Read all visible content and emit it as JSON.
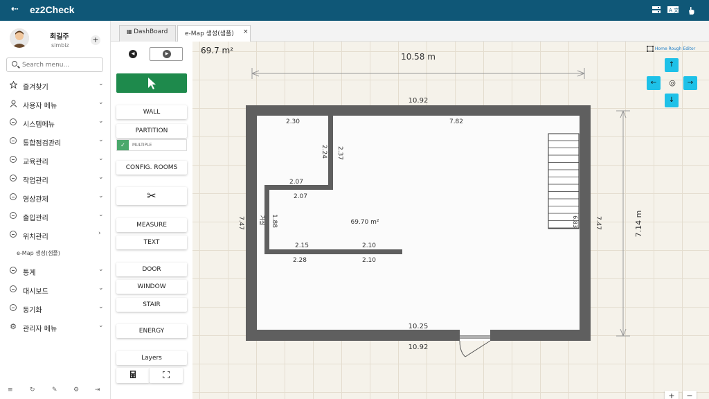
{
  "app": {
    "title": "ez2Check",
    "menu_toggle": "⇠"
  },
  "topbar": {
    "icons": [
      "server-icon",
      "translate-icon",
      "touch-icon"
    ]
  },
  "user": {
    "name": "최길주",
    "org": "simbiz",
    "add": "+"
  },
  "search": {
    "placeholder": "Search menu..."
  },
  "nav": [
    {
      "label": "즐겨찾기",
      "icon": "star-icon",
      "chev": "⌄"
    },
    {
      "label": "사용자 메뉴",
      "icon": "user-icon",
      "chev": "⌄"
    },
    {
      "label": "시스템메뉴",
      "icon": "minus-circle-icon",
      "chev": "⌄"
    },
    {
      "label": "통합점검관리",
      "icon": "minus-circle-icon",
      "chev": "⌄"
    },
    {
      "label": "교육관리",
      "icon": "minus-circle-icon",
      "chev": "⌄"
    },
    {
      "label": "작업관리",
      "icon": "minus-circle-icon",
      "chev": "⌄"
    },
    {
      "label": "영상관제",
      "icon": "minus-circle-icon",
      "chev": "⌄"
    },
    {
      "label": "출입관리",
      "icon": "minus-circle-icon",
      "chev": "⌄"
    },
    {
      "label": "위치관리",
      "icon": "minus-circle-icon",
      "chev": "›"
    },
    {
      "label": "통계",
      "icon": "minus-circle-icon",
      "chev": "⌄"
    },
    {
      "label": "대시보드",
      "icon": "minus-circle-icon",
      "chev": "⌄"
    },
    {
      "label": "동기화",
      "icon": "minus-circle-icon",
      "chev": "⌄"
    },
    {
      "label": "관리자 메뉴",
      "icon": "gear-icon",
      "chev": "⌄"
    }
  ],
  "nav_sub": "e-Map 생성(샘플)",
  "tabs": [
    {
      "label": "DashBoard",
      "icon": "table-icon"
    },
    {
      "label": "e-Map 생성(샘플)",
      "close": "×"
    }
  ],
  "tools": {
    "prev": "◀",
    "next": "▶",
    "wall": "WALL",
    "partition": "PARTITION",
    "multiple": "MULTIPLE",
    "multiple_checked": "✓",
    "config_rooms": "CONFIG. ROOMS",
    "cut": "✂",
    "measure": "MEASURE",
    "text": "TEXT",
    "door": "DOOR",
    "window": "WINDOW",
    "stair": "STAIR",
    "energy": "ENERGY",
    "layers": "Layers"
  },
  "canvas": {
    "total_area": "69.7 m²",
    "editor_link": "Home Rough Editor",
    "width_dim": "10.58 m",
    "height_dim": "7.14 m",
    "room_area": "69.70 m²",
    "room_label": "거실",
    "dims": {
      "top_outer": "10.92",
      "bottom_inner": "10.25",
      "bottom_outer": "10.92",
      "left_outer": "7.47",
      "right_outer": "7.47",
      "room_top": "2.30",
      "room_right_top": "7.82",
      "part_v1": "2.24",
      "part_v2": "2.37",
      "part_h1": "2.07",
      "part_h2": "2.07",
      "part_left": "1.88",
      "part_bottom1": "2.15",
      "part_bottom2": "2.10",
      "part_bottom3": "2.28",
      "part_bottom4": "2.10",
      "stair_side": "6.83"
    },
    "nav": {
      "up": "↑",
      "down": "↓",
      "left": "←",
      "right": "→",
      "center": "◎"
    },
    "zoom_in": "+",
    "zoom_out": "−"
  },
  "sidebar_bottom": [
    "≡",
    "↻",
    "✎",
    "⚙",
    "⇥"
  ]
}
